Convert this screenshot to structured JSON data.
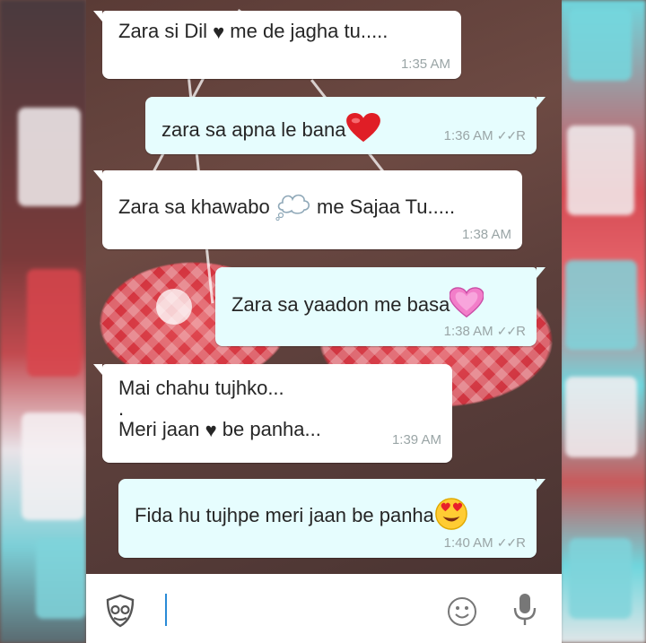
{
  "messages": [
    {
      "direction": "in",
      "text_before": "Zara si Dil ",
      "emoji": "black-heart",
      "text_after": " me de jagha tu.....",
      "time": "1:35 AM"
    },
    {
      "direction": "out",
      "text_before": "zara sa apna le bana",
      "emoji": "red-heart",
      "time": "1:36 AM",
      "status": "R"
    },
    {
      "direction": "in",
      "text_before": "Zara sa khawabo ",
      "emoji": "thought-balloon",
      "text_after": " me Sajaa Tu.....",
      "time": "1:38 AM"
    },
    {
      "direction": "out",
      "text_before": "Zara sa yaadon me basa",
      "emoji": "pink-heart",
      "time": "1:38 AM",
      "status": "R"
    },
    {
      "direction": "in",
      "line1": "Mai chahu tujhko...",
      "line2": ".",
      "line3_before": "Meri jaan ",
      "line3_emoji": "black-heart",
      "line3_after": " be panha...",
      "time": "1:39 AM"
    },
    {
      "direction": "out",
      "text_before": "Fida hu tujhpe meri jaan be panha",
      "emoji": "heart-eyes-face",
      "time": "1:40 AM",
      "status": "R"
    }
  ],
  "input": {
    "value": "",
    "placeholder": ""
  },
  "icons": {
    "left": "incognito-mask-icon",
    "emoji": "smiley-icon",
    "mic": "microphone-icon"
  },
  "colors": {
    "incoming_bubble": "#ffffff",
    "outgoing_bubble": "#e6fdfe",
    "meta_text": "#9aa5a6",
    "cursor": "#2a8bd6"
  }
}
